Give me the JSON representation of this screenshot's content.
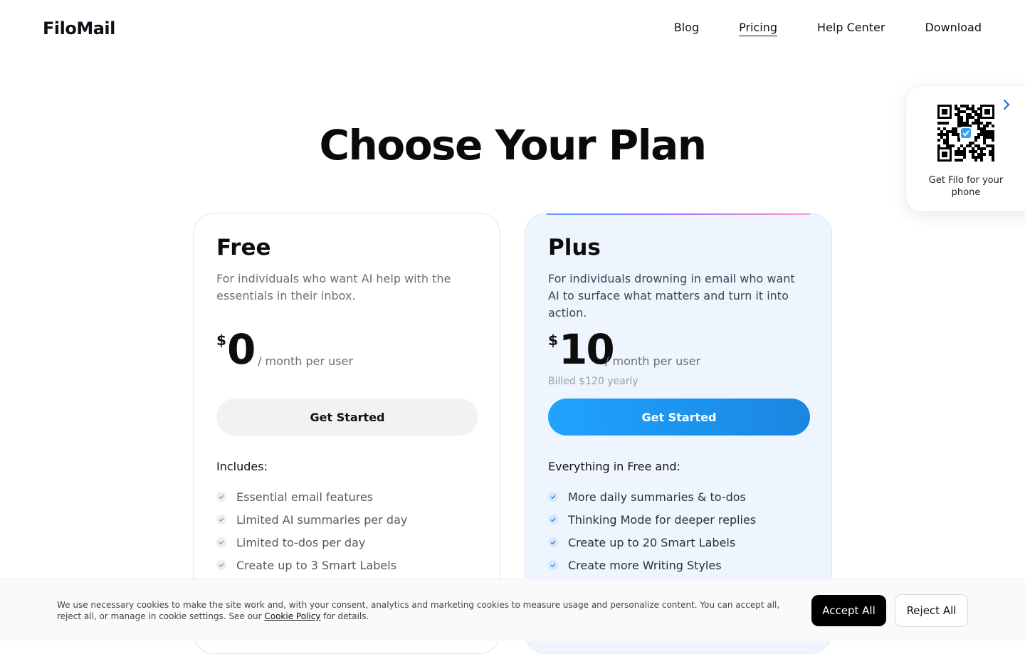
{
  "header": {
    "logo": "FiloMail",
    "nav": [
      {
        "label": "Blog"
      },
      {
        "label": "Pricing",
        "active": true
      },
      {
        "label": "Help Center"
      },
      {
        "label": "Download"
      }
    ]
  },
  "qr_widget": {
    "caption": "Get Filo for your phone",
    "icon": "qr-code-icon"
  },
  "page_title": "Choose Your Plan",
  "plans": [
    {
      "name": "Free",
      "description": "For individuals who want AI help with the essentials in their inbox.",
      "currency": "$",
      "price": "0",
      "period": "/ month per user",
      "billed": "",
      "cta": "Get Started",
      "includes_heading": "Includes:",
      "features": [
        "Essential email features",
        "Limited AI summaries per day",
        "Limited to-dos per day",
        "Create up to 3 Smart Labels"
      ]
    },
    {
      "name": "Plus",
      "description": "For individuals drowning in email who want AI to surface what matters and turn it into action.",
      "currency": "$",
      "price": "10",
      "period": "/ month per user",
      "billed": "Billed $120 yearly",
      "cta": "Get Started",
      "includes_heading": "Everything in Free and:",
      "features": [
        "More daily summaries & to-dos",
        "Thinking Mode for deeper replies",
        "Create up to 20 Smart Labels",
        "Create more Writing Styles"
      ]
    }
  ],
  "cookie_banner": {
    "text_before": "We use necessary cookies to make the site work and, with your consent, analytics and marketing cookies to measure usage and personalize content. You can accept all, reject all, or manage in cookie settings. See our ",
    "link": "Cookie Policy",
    "text_after": " for details.",
    "accept": "Accept All",
    "reject": "Reject All"
  },
  "colors": {
    "accent": "#1b95f0",
    "plus_bg": "#eff5ff",
    "check_free": "#9aa0aa",
    "check_plus": "#2d8cf0"
  }
}
